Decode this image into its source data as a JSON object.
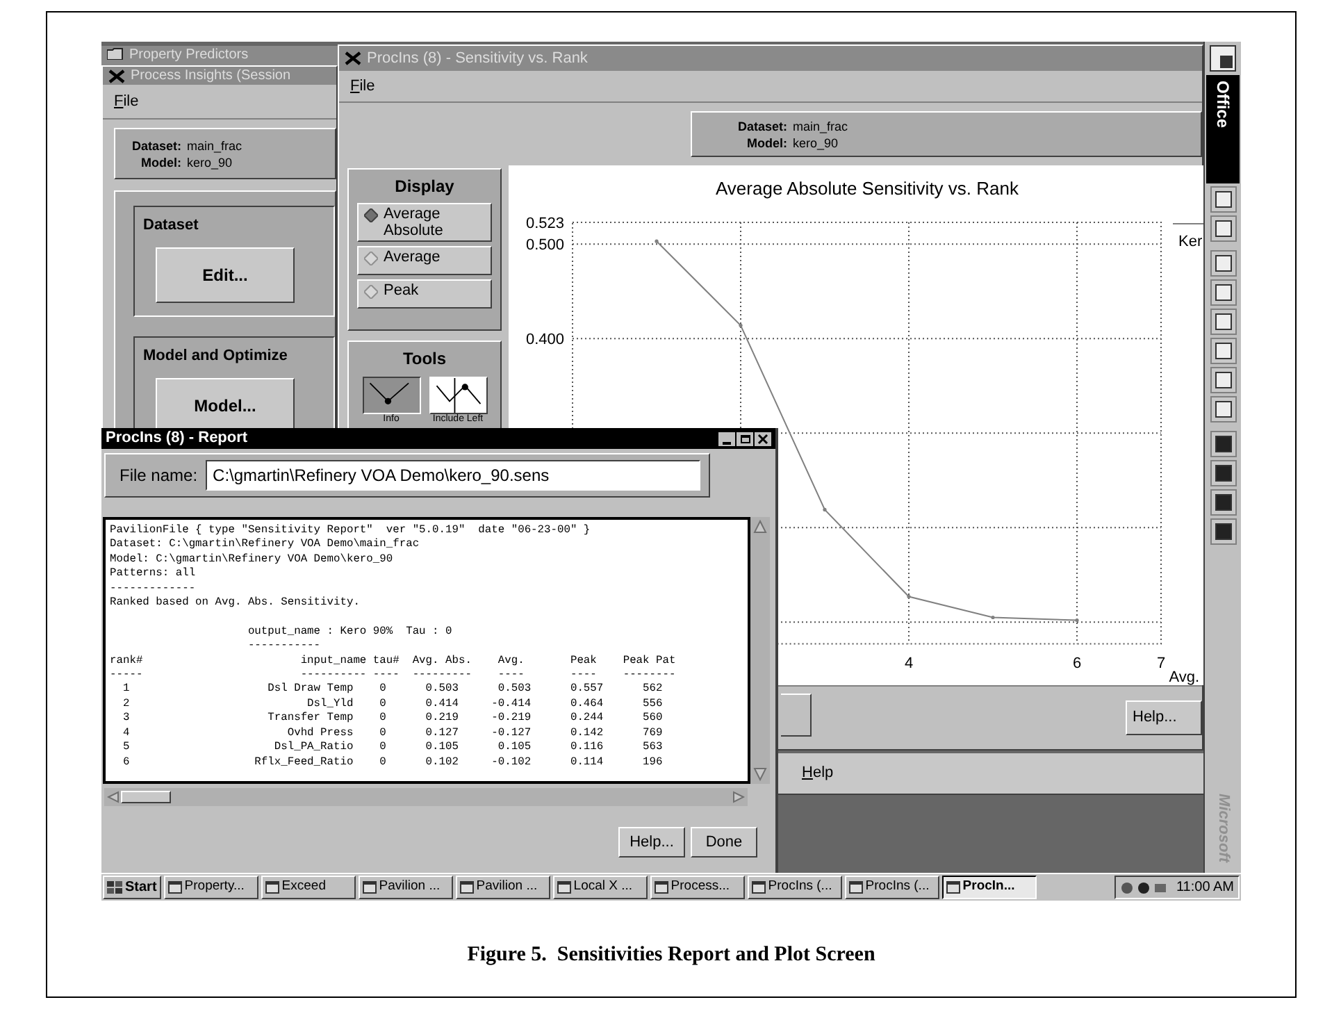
{
  "screen": {
    "property_predictors": {
      "title": "Property Predictors"
    },
    "process_insights": {
      "title": "Process Insights (Session",
      "menu": [
        "File"
      ],
      "info": {
        "dataset_label": "Dataset:",
        "dataset": "main_frac",
        "model_label": "Model:",
        "model": "kero_90"
      },
      "groups": [
        {
          "title": "Dataset",
          "button": "Edit..."
        },
        {
          "title": "Model and Optimize",
          "button": "Model..."
        }
      ]
    },
    "help_menu": {
      "items": [
        "Help"
      ]
    },
    "sensitivity": {
      "title": "ProcIns (8) - Sensitivity vs. Rank",
      "menu": [
        "File"
      ],
      "info": {
        "dataset_label": "Dataset:",
        "dataset": "main_frac",
        "model_label": "Model:",
        "model": "kero_90"
      },
      "display": {
        "title": "Display",
        "options": [
          {
            "label": "Average Absolute",
            "selected": true
          },
          {
            "label": "Average",
            "selected": false
          },
          {
            "label": "Peak",
            "selected": false
          }
        ]
      },
      "tools": {
        "title": "Tools",
        "items": [
          {
            "label": "Info",
            "selected": true
          },
          {
            "label": "Include Left",
            "selected": false
          }
        ]
      },
      "chart_data": {
        "type": "line",
        "title": "Average Absolute Sensitivity vs. Rank",
        "xlabel": "Avg.",
        "x": [
          1,
          2,
          3,
          4,
          5,
          6
        ],
        "series": [
          {
            "name": "Ker",
            "color": "#808080",
            "values": [
              0.503,
              0.414,
              0.219,
              0.127,
              0.105,
              0.102
            ]
          }
        ],
        "grid": true,
        "xlim": [
          0,
          7
        ],
        "ylim": [
          0.077,
          0.523
        ],
        "xticks": [
          4,
          6,
          7
        ],
        "yticks": [
          {
            "value": 0.4,
            "label": "0.400"
          },
          {
            "value": 0.5,
            "label": "0.500"
          },
          {
            "value": 0.523,
            "label": "0.523"
          }
        ]
      },
      "buttons": [
        "Help..."
      ]
    },
    "report": {
      "title": "ProcIns (8) - Report",
      "file_label": "File name:",
      "file_name": "C:\\gmartin\\Refinery VOA Demo\\kero_90.sens",
      "lines": [
        "PavilionFile { type \"Sensitivity Report\"  ver \"5.0.19\"  date \"06-23-00\" }",
        "Dataset: C:\\gmartin\\Refinery VOA Demo\\main_frac",
        "Model: C:\\gmartin\\Refinery VOA Demo\\kero_90",
        "Patterns: all",
        "-------------",
        "Ranked based on Avg. Abs. Sensitivity."
      ],
      "table_lines": [
        "                     output_name : Kero 90%  Tau : 0",
        "                     -----------",
        "rank#                        input_name tau#  Avg. Abs.    Avg.       Peak    Peak Pat",
        "-----                        ---------- ----  ---------    ----       ----    --------",
        "  1                     Dsl Draw Temp    0      0.503      0.503      0.557      562",
        "  2                           Dsl_Yld    0      0.414     -0.414      0.464      556",
        "  3                     Transfer Temp    0      0.219     -0.219      0.244      560",
        "  4                        Ovhd Press    0      0.127     -0.127      0.142      769",
        "  5                      Dsl_PA_Ratio    0      0.105      0.105      0.116      563",
        "  6                   Rflx_Feed_Ratio    0      0.102     -0.102      0.114      196"
      ],
      "buttons": [
        "Help...",
        "Done"
      ]
    },
    "office_bar": {
      "title": "Office",
      "brand": "Microsoft"
    },
    "taskbar": {
      "start": "Start",
      "tasks": [
        {
          "label": "Property...",
          "selected": false
        },
        {
          "label": "Exceed",
          "selected": false
        },
        {
          "label": "Pavilion ...",
          "selected": false
        },
        {
          "label": "Pavilion ...",
          "selected": false
        },
        {
          "label": "Local X ...",
          "selected": false
        },
        {
          "label": "Process...",
          "selected": false
        },
        {
          "label": "ProcIns (...",
          "selected": false
        },
        {
          "label": "ProcIns (...",
          "selected": false
        },
        {
          "label": "ProcIn...",
          "selected": true
        }
      ],
      "clock": "11:00 AM"
    }
  },
  "caption": "Figure 5.  Sensitivities Report and Plot Screen"
}
